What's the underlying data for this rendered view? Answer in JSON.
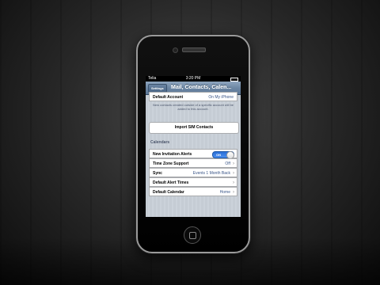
{
  "status": {
    "carrier": "Telia",
    "time": "3:20 PM"
  },
  "nav": {
    "back_label": "Settings",
    "title": "Mail, Contacts, Calen..."
  },
  "contacts": {
    "default_account_label": "Default Account",
    "default_account_value": "On My iPhone",
    "footnote": "New contacts created outside of a specific account will be added to this account.",
    "import_sim_label": "Import SIM Contacts"
  },
  "calendars": {
    "header": "Calendars",
    "rows": [
      {
        "label": "New Invitation Alerts",
        "toggle": "ON"
      },
      {
        "label": "Time Zone Support",
        "value": "Off"
      },
      {
        "label": "Sync",
        "value": "Events 1 Month Back"
      },
      {
        "label": "Default Alert Times",
        "value": ""
      },
      {
        "label": "Default Calendar",
        "value": "Home"
      }
    ]
  },
  "colors": {
    "nav_bar": "#6d87a4",
    "accent_value": "#385487",
    "toggle_on": "#2a6fd6"
  },
  "icons": {
    "disclosure": "chevron-right-icon",
    "home": "home-button-icon"
  }
}
